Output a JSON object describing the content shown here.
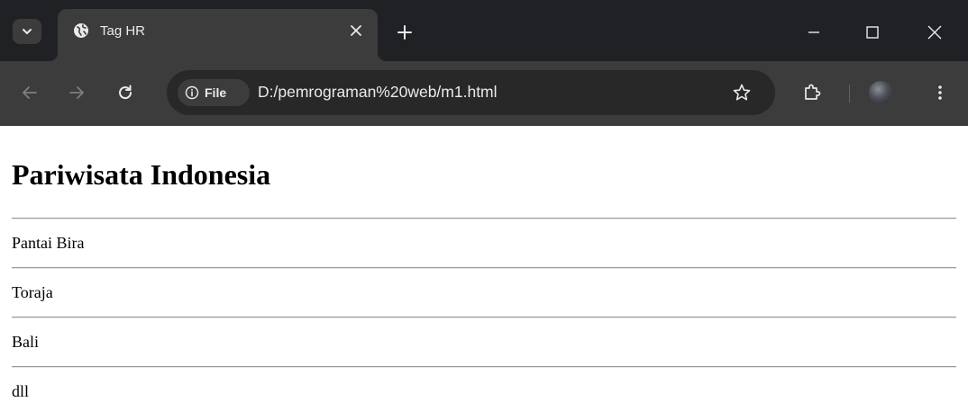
{
  "browser": {
    "tab": {
      "title": "Tag HR"
    },
    "address_bar": {
      "security_chip": "File",
      "url": "D:/pemrograman%20web/m1.html"
    }
  },
  "page": {
    "heading": "Pariwisata Indonesia",
    "items": [
      "Pantai Bira",
      "Toraja",
      "Bali",
      "dll"
    ]
  }
}
